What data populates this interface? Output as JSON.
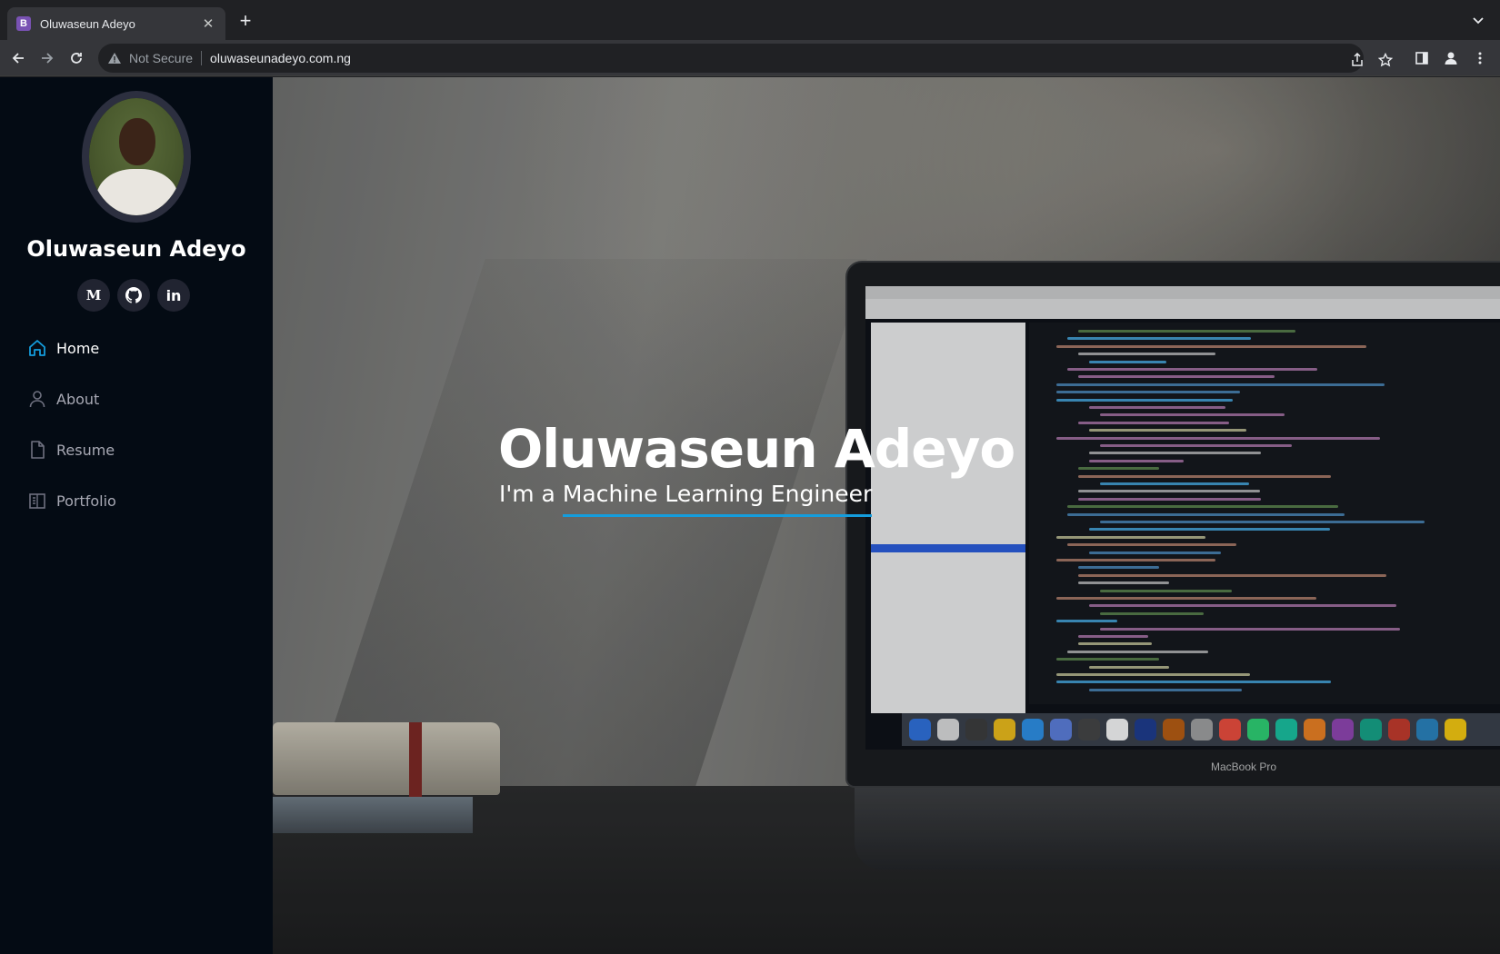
{
  "browser": {
    "tab_title": "Oluwaseun Adeyo",
    "favicon_letter": "B",
    "security_label": "Not Secure",
    "url": "oluwaseunadeyo.com.ng"
  },
  "sidebar": {
    "name": "Oluwaseun Adeyo",
    "socials": [
      {
        "name": "medium",
        "glyph": "M"
      },
      {
        "name": "github",
        "glyph": ""
      },
      {
        "name": "linkedin",
        "glyph": "in"
      }
    ],
    "nav": [
      {
        "label": "Home",
        "icon": "home-icon",
        "active": true
      },
      {
        "label": "About",
        "icon": "person-icon",
        "active": false
      },
      {
        "label": "Resume",
        "icon": "file-icon",
        "active": false
      },
      {
        "label": "Portfolio",
        "icon": "book-icon",
        "active": false
      }
    ]
  },
  "hero": {
    "title": "Oluwaseun Adeyo",
    "subtitle_prefix": "I'm a ",
    "subtitle_typed": "Machine Learning Engineer",
    "laptop_label": "MacBook Pro"
  },
  "colors": {
    "accent": "#149ddd",
    "sidebar_bg": "#040b14",
    "social_bg": "#212431",
    "nav_text": "#a8a9b4"
  }
}
